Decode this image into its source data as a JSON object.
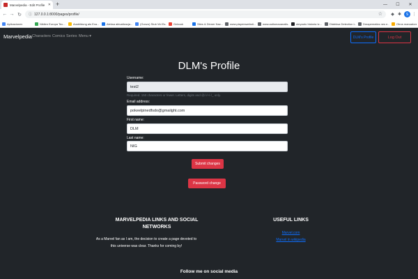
{
  "browser": {
    "tab_title": "Marvelpedia - Edit Profile",
    "new_tab": "+",
    "url": "127.0.0.1:8000/pages/profile/",
    "profile_initial": "S",
    "bookmarks": [
      {
        "label": "Aplicaciones",
        "color": "#4285f4"
      },
      {
        "label": "Niklien Europa Tec...",
        "color": "#34a853"
      },
      {
        "label": "Ausbildung als Exa...",
        "color": "#fbbc05"
      },
      {
        "label": "Aleksa aktualizacja...",
        "color": "#1a73e8"
      },
      {
        "label": "(Gonzo) Stub Vid Es...",
        "color": "#4285f4"
      },
      {
        "label": "Gnbook",
        "color": "#ea4335"
      },
      {
        "label": "Sites & Dinner Nav...",
        "color": "#1a73e8"
      },
      {
        "label": "www.playerswebsit...",
        "color": "#5f6368"
      },
      {
        "label": "www.autismaoanalis...",
        "color": "#5f6368"
      },
      {
        "label": "ukryauto historia tz...",
        "color": "#202124"
      },
      {
        "label": "Dlaleksa Detection L...",
        "color": "#5f6368"
      },
      {
        "label": "Dmapematics nes e...",
        "color": "#5f6368"
      }
    ],
    "other_bookmarks": "Otros marcadores"
  },
  "navbar": {
    "brand": "Marvelpedia",
    "links": [
      "Characters",
      "Comics",
      "Series",
      "Menu ▾"
    ],
    "profile_button": "DLM's Profile",
    "logout_button": "Log Out"
  },
  "form": {
    "title": "DLM's Profile",
    "username_label": "Username:",
    "username_value": "test2",
    "username_help": "Required. 150 characters or fewer. Letters, digits and @/./+/-/_ only.",
    "email_label": "Email address:",
    "email_value": "pokeelpinedfsdo@gmailght.com",
    "first_name_label": "First name:",
    "first_name_value": "DLM",
    "last_name_label": "Last name:",
    "last_name_value": "NIG",
    "submit_button": "Submit changes",
    "password_button": "Password change"
  },
  "footer": {
    "links_title": "MARVELPEDIA LINKS AND SOCIAL NETWORKS",
    "about_text": "As a Marvel fan as I am, the decision to create a page devoted to this universe was clear. Thanks for coming by!",
    "useful_title": "USEFUL LINKS",
    "useful_links": [
      "Marvel.com",
      "Marvel in wikipedia"
    ],
    "follow": "Follow me on social media"
  }
}
